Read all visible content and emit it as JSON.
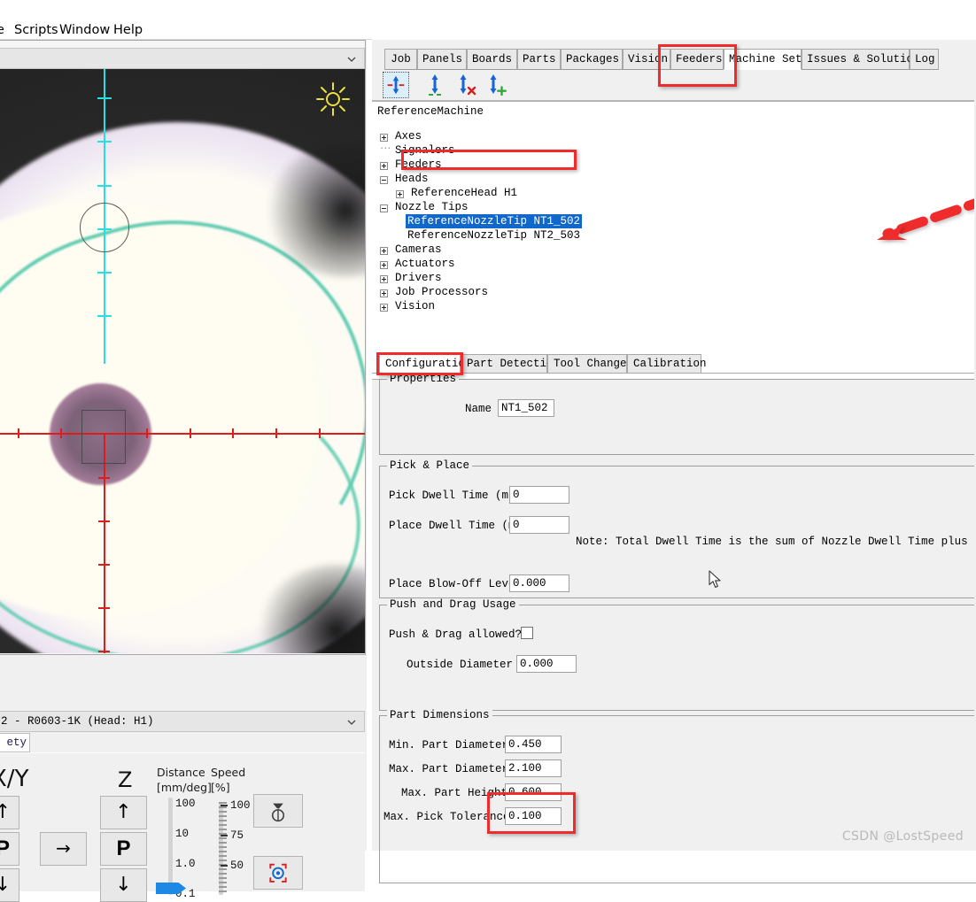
{
  "menubar": {
    "items": [
      {
        "label": "e"
      },
      {
        "label": "Scripts"
      },
      {
        "label": "Window"
      },
      {
        "label": "Help"
      }
    ]
  },
  "left_panel": {
    "camera_combo": {
      "value": "",
      "chevron_icon": "chevron-down-icon"
    },
    "camera_view": {
      "sun_icon": "sun-icon",
      "overlay": "crosshair-reticle"
    },
    "machine_combo": {
      "value": "2 - R0603-1K  (Head: H1)",
      "chevron_icon": "chevron-down-icon"
    },
    "jog_tab": {
      "label": "ety"
    },
    "jog": {
      "xy_label": "X/Y",
      "z_label": "Z",
      "distance_label": "Distance",
      "distance_unit": "[mm/deg]",
      "speed_label": "Speed",
      "speed_unit": "[%]",
      "buttons": {
        "xy_up": "↑",
        "xy_park": "P",
        "xy_down": "↓",
        "xy_right": "→",
        "z_up": "↑",
        "z_park": "P",
        "z_down": "↓",
        "nozzle_icon": "nozzle-pickup-icon",
        "target_icon": "target-crosshair-icon"
      },
      "distance_ticks": [
        "100",
        "10",
        "1.0",
        "0.1"
      ],
      "speed_ticks": [
        "100",
        "75",
        "50"
      ]
    }
  },
  "right_panel": {
    "tabs": [
      {
        "label": "Job",
        "selected": false
      },
      {
        "label": "Panels",
        "selected": false
      },
      {
        "label": "Boards",
        "selected": false
      },
      {
        "label": "Parts",
        "selected": false
      },
      {
        "label": "Packages",
        "selected": false
      },
      {
        "label": "Vision",
        "selected": false
      },
      {
        "label": "Feeders",
        "selected": false
      },
      {
        "label": "Machine Setup",
        "selected": true
      },
      {
        "label": "Issues & Solutions",
        "selected": false
      },
      {
        "label": "Log",
        "selected": false
      }
    ],
    "toolbar": [
      {
        "name": "nozzle-tip-edit-icon",
        "active": true
      },
      {
        "name": "nozzle-tip-load-icon",
        "active": false
      },
      {
        "name": "nozzle-tip-delete-icon",
        "active": false
      },
      {
        "name": "nozzle-tip-add-icon",
        "active": false
      }
    ],
    "tree": {
      "root": "ReferenceMachine",
      "nodes": [
        {
          "label": "Axes",
          "depth": 1,
          "expander": "plus"
        },
        {
          "label": "Signalers",
          "depth": 1,
          "expander": "none"
        },
        {
          "label": "Feeders",
          "depth": 1,
          "expander": "plus"
        },
        {
          "label": "Heads",
          "depth": 1,
          "expander": "minus"
        },
        {
          "label": "ReferenceHead H1",
          "depth": 2,
          "expander": "plus"
        },
        {
          "label": "Nozzle Tips",
          "depth": 1,
          "expander": "minus"
        },
        {
          "label": "ReferenceNozzleTip NT1_502",
          "depth": 3,
          "expander": "none",
          "selected": true
        },
        {
          "label": "ReferenceNozzleTip NT2_503",
          "depth": 3,
          "expander": "none"
        },
        {
          "label": "Cameras",
          "depth": 1,
          "expander": "plus"
        },
        {
          "label": "Actuators",
          "depth": 1,
          "expander": "plus"
        },
        {
          "label": "Drivers",
          "depth": 1,
          "expander": "plus"
        },
        {
          "label": "Job Processors",
          "depth": 1,
          "expander": "plus"
        },
        {
          "label": "Vision",
          "depth": 1,
          "expander": "plus"
        }
      ]
    },
    "lower_tabs": [
      {
        "label": "Configuration",
        "selected": true
      },
      {
        "label": "Part Detection",
        "selected": false
      },
      {
        "label": "Tool Changer",
        "selected": false
      },
      {
        "label": "Calibration",
        "selected": false
      }
    ],
    "properties": {
      "title": "Properties",
      "name_label": "Name",
      "name_value": "NT1_502"
    },
    "pick_and_place": {
      "title": "Pick & Place",
      "pick_dwell_label": "Pick Dwell Time (ms)",
      "pick_dwell_value": "0",
      "place_dwell_label": "Place Dwell Time (ms)",
      "place_dwell_value": "0",
      "blow_off_label": "Place Blow-Off Level",
      "blow_off_value": "0.000",
      "note": "Note: Total Dwell Time is the sum of Nozzle Dwell Time plus the Nozzle Tip Dw"
    },
    "push_and_drag": {
      "title": "Push and Drag Usage",
      "allowed_label": "Push & Drag allowed?",
      "allowed_checked": false,
      "outside_diameter_label": "Outside Diameter",
      "outside_diameter_value": "0.000"
    },
    "part_dimensions": {
      "title": "Part Dimensions",
      "min_diameter_label": "Min. Part Diameter",
      "min_diameter_value": "0.450",
      "max_diameter_label": "Max. Part Diameter",
      "max_diameter_value": "2.100",
      "max_height_label": "Max. Part Height",
      "max_height_value": "0.600",
      "max_pick_tolerance_label": "Max. Pick Tolerance",
      "max_pick_tolerance_value": "0.100"
    }
  },
  "annotations": {
    "highlight_color": "#ef2b2b",
    "arrow": "dashed-red-arrow-pointing-to-nozzle-tip"
  },
  "watermark": {
    "text": "CSDN @LostSpeed"
  }
}
